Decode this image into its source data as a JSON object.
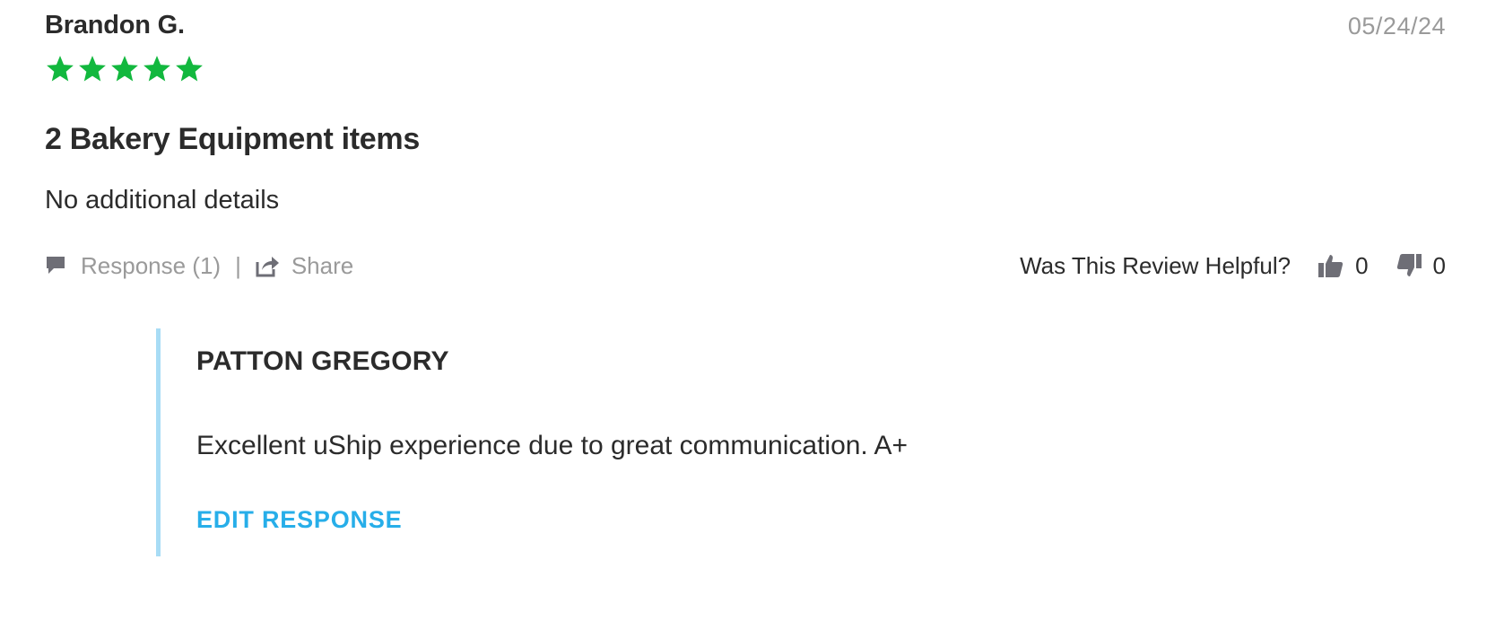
{
  "review": {
    "reviewer_name": "Brandon G.",
    "date": "05/24/24",
    "rating": 5,
    "rating_max": 5,
    "star_color": "#12b83e",
    "title": "2 Bakery Equipment items",
    "body": "No additional details"
  },
  "actions": {
    "response_label": "Response (1)",
    "divider": "|",
    "share_label": "Share",
    "response_icon": "speech-bubble-icon",
    "share_icon": "share-icon"
  },
  "helpful": {
    "label": "Was This Review Helpful?",
    "up_count": "0",
    "down_count": "0",
    "up_icon": "thumbs-up-icon",
    "down_icon": "thumbs-down-icon"
  },
  "response": {
    "author": "PATTON GREGORY",
    "text": "Excellent uShip experience due to great communication. A+",
    "edit_label": "EDIT RESPONSE",
    "accent_color": "#27aee9",
    "border_color": "#a8dcf5"
  }
}
